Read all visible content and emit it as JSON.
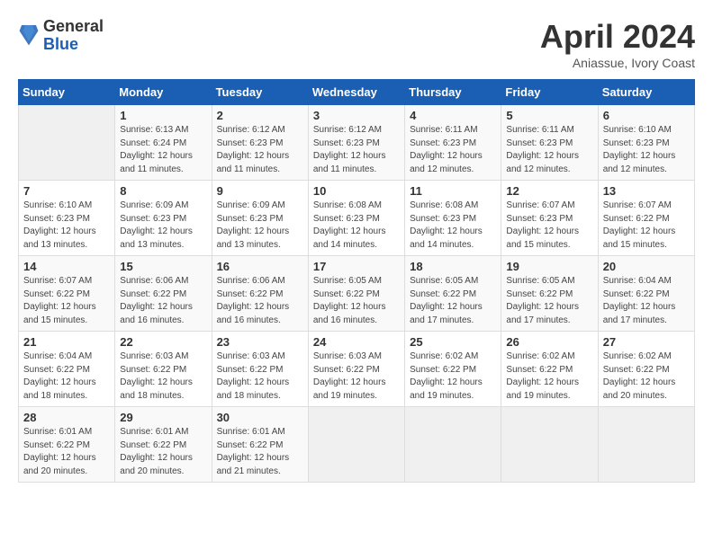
{
  "header": {
    "logo_general": "General",
    "logo_blue": "Blue",
    "month_title": "April 2024",
    "location": "Aniassue, Ivory Coast"
  },
  "calendar": {
    "days_of_week": [
      "Sunday",
      "Monday",
      "Tuesday",
      "Wednesday",
      "Thursday",
      "Friday",
      "Saturday"
    ],
    "weeks": [
      [
        {
          "day": "",
          "info": ""
        },
        {
          "day": "1",
          "info": "Sunrise: 6:13 AM\nSunset: 6:24 PM\nDaylight: 12 hours\nand 11 minutes."
        },
        {
          "day": "2",
          "info": "Sunrise: 6:12 AM\nSunset: 6:23 PM\nDaylight: 12 hours\nand 11 minutes."
        },
        {
          "day": "3",
          "info": "Sunrise: 6:12 AM\nSunset: 6:23 PM\nDaylight: 12 hours\nand 11 minutes."
        },
        {
          "day": "4",
          "info": "Sunrise: 6:11 AM\nSunset: 6:23 PM\nDaylight: 12 hours\nand 12 minutes."
        },
        {
          "day": "5",
          "info": "Sunrise: 6:11 AM\nSunset: 6:23 PM\nDaylight: 12 hours\nand 12 minutes."
        },
        {
          "day": "6",
          "info": "Sunrise: 6:10 AM\nSunset: 6:23 PM\nDaylight: 12 hours\nand 12 minutes."
        }
      ],
      [
        {
          "day": "7",
          "info": "Sunrise: 6:10 AM\nSunset: 6:23 PM\nDaylight: 12 hours\nand 13 minutes."
        },
        {
          "day": "8",
          "info": "Sunrise: 6:09 AM\nSunset: 6:23 PM\nDaylight: 12 hours\nand 13 minutes."
        },
        {
          "day": "9",
          "info": "Sunrise: 6:09 AM\nSunset: 6:23 PM\nDaylight: 12 hours\nand 13 minutes."
        },
        {
          "day": "10",
          "info": "Sunrise: 6:08 AM\nSunset: 6:23 PM\nDaylight: 12 hours\nand 14 minutes."
        },
        {
          "day": "11",
          "info": "Sunrise: 6:08 AM\nSunset: 6:23 PM\nDaylight: 12 hours\nand 14 minutes."
        },
        {
          "day": "12",
          "info": "Sunrise: 6:07 AM\nSunset: 6:23 PM\nDaylight: 12 hours\nand 15 minutes."
        },
        {
          "day": "13",
          "info": "Sunrise: 6:07 AM\nSunset: 6:22 PM\nDaylight: 12 hours\nand 15 minutes."
        }
      ],
      [
        {
          "day": "14",
          "info": "Sunrise: 6:07 AM\nSunset: 6:22 PM\nDaylight: 12 hours\nand 15 minutes."
        },
        {
          "day": "15",
          "info": "Sunrise: 6:06 AM\nSunset: 6:22 PM\nDaylight: 12 hours\nand 16 minutes."
        },
        {
          "day": "16",
          "info": "Sunrise: 6:06 AM\nSunset: 6:22 PM\nDaylight: 12 hours\nand 16 minutes."
        },
        {
          "day": "17",
          "info": "Sunrise: 6:05 AM\nSunset: 6:22 PM\nDaylight: 12 hours\nand 16 minutes."
        },
        {
          "day": "18",
          "info": "Sunrise: 6:05 AM\nSunset: 6:22 PM\nDaylight: 12 hours\nand 17 minutes."
        },
        {
          "day": "19",
          "info": "Sunrise: 6:05 AM\nSunset: 6:22 PM\nDaylight: 12 hours\nand 17 minutes."
        },
        {
          "day": "20",
          "info": "Sunrise: 6:04 AM\nSunset: 6:22 PM\nDaylight: 12 hours\nand 17 minutes."
        }
      ],
      [
        {
          "day": "21",
          "info": "Sunrise: 6:04 AM\nSunset: 6:22 PM\nDaylight: 12 hours\nand 18 minutes."
        },
        {
          "day": "22",
          "info": "Sunrise: 6:03 AM\nSunset: 6:22 PM\nDaylight: 12 hours\nand 18 minutes."
        },
        {
          "day": "23",
          "info": "Sunrise: 6:03 AM\nSunset: 6:22 PM\nDaylight: 12 hours\nand 18 minutes."
        },
        {
          "day": "24",
          "info": "Sunrise: 6:03 AM\nSunset: 6:22 PM\nDaylight: 12 hours\nand 19 minutes."
        },
        {
          "day": "25",
          "info": "Sunrise: 6:02 AM\nSunset: 6:22 PM\nDaylight: 12 hours\nand 19 minutes."
        },
        {
          "day": "26",
          "info": "Sunrise: 6:02 AM\nSunset: 6:22 PM\nDaylight: 12 hours\nand 19 minutes."
        },
        {
          "day": "27",
          "info": "Sunrise: 6:02 AM\nSunset: 6:22 PM\nDaylight: 12 hours\nand 20 minutes."
        }
      ],
      [
        {
          "day": "28",
          "info": "Sunrise: 6:01 AM\nSunset: 6:22 PM\nDaylight: 12 hours\nand 20 minutes."
        },
        {
          "day": "29",
          "info": "Sunrise: 6:01 AM\nSunset: 6:22 PM\nDaylight: 12 hours\nand 20 minutes."
        },
        {
          "day": "30",
          "info": "Sunrise: 6:01 AM\nSunset: 6:22 PM\nDaylight: 12 hours\nand 21 minutes."
        },
        {
          "day": "",
          "info": ""
        },
        {
          "day": "",
          "info": ""
        },
        {
          "day": "",
          "info": ""
        },
        {
          "day": "",
          "info": ""
        }
      ]
    ]
  }
}
